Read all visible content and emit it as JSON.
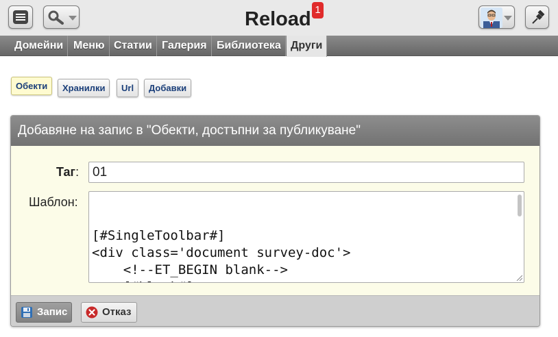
{
  "header": {
    "title": "Reload",
    "notification_count": "1",
    "icons": {
      "menu": "hamburger-menu-icon",
      "search": "search-icon",
      "pin": "pin-icon"
    }
  },
  "nav": {
    "items": [
      {
        "label": "Домейни"
      },
      {
        "label": "Меню"
      },
      {
        "label": "Статии"
      },
      {
        "label": "Галерия"
      },
      {
        "label": "Библиотека"
      },
      {
        "label": "Други",
        "active": true
      }
    ]
  },
  "subtabs": {
    "items": [
      {
        "label": "Обекти",
        "active": true
      },
      {
        "label": "Хранилки"
      },
      {
        "label": "Url"
      },
      {
        "label": "Добавки"
      }
    ]
  },
  "form": {
    "title": "Добавяне на запис в \"Обекти, достъпни за публикуване\"",
    "tag_label": "Таг",
    "tag_colon": ":",
    "tag_value": "01",
    "template_label": "Шаблон:",
    "template_value": "[#SingleToolbar#]\n<div class='document survey-doc'>\n    <!--ET_BEGIN blank-->\n    [#blank#]\n    <!--ET_END blank-->",
    "save_label": "Запис",
    "cancel_label": "Отказ"
  },
  "colors": {
    "accent_badge": "#e02b2b",
    "nav_bg": "#777777",
    "panel_bg": "#fcfce8",
    "link_blue": "#1b3f7a"
  }
}
